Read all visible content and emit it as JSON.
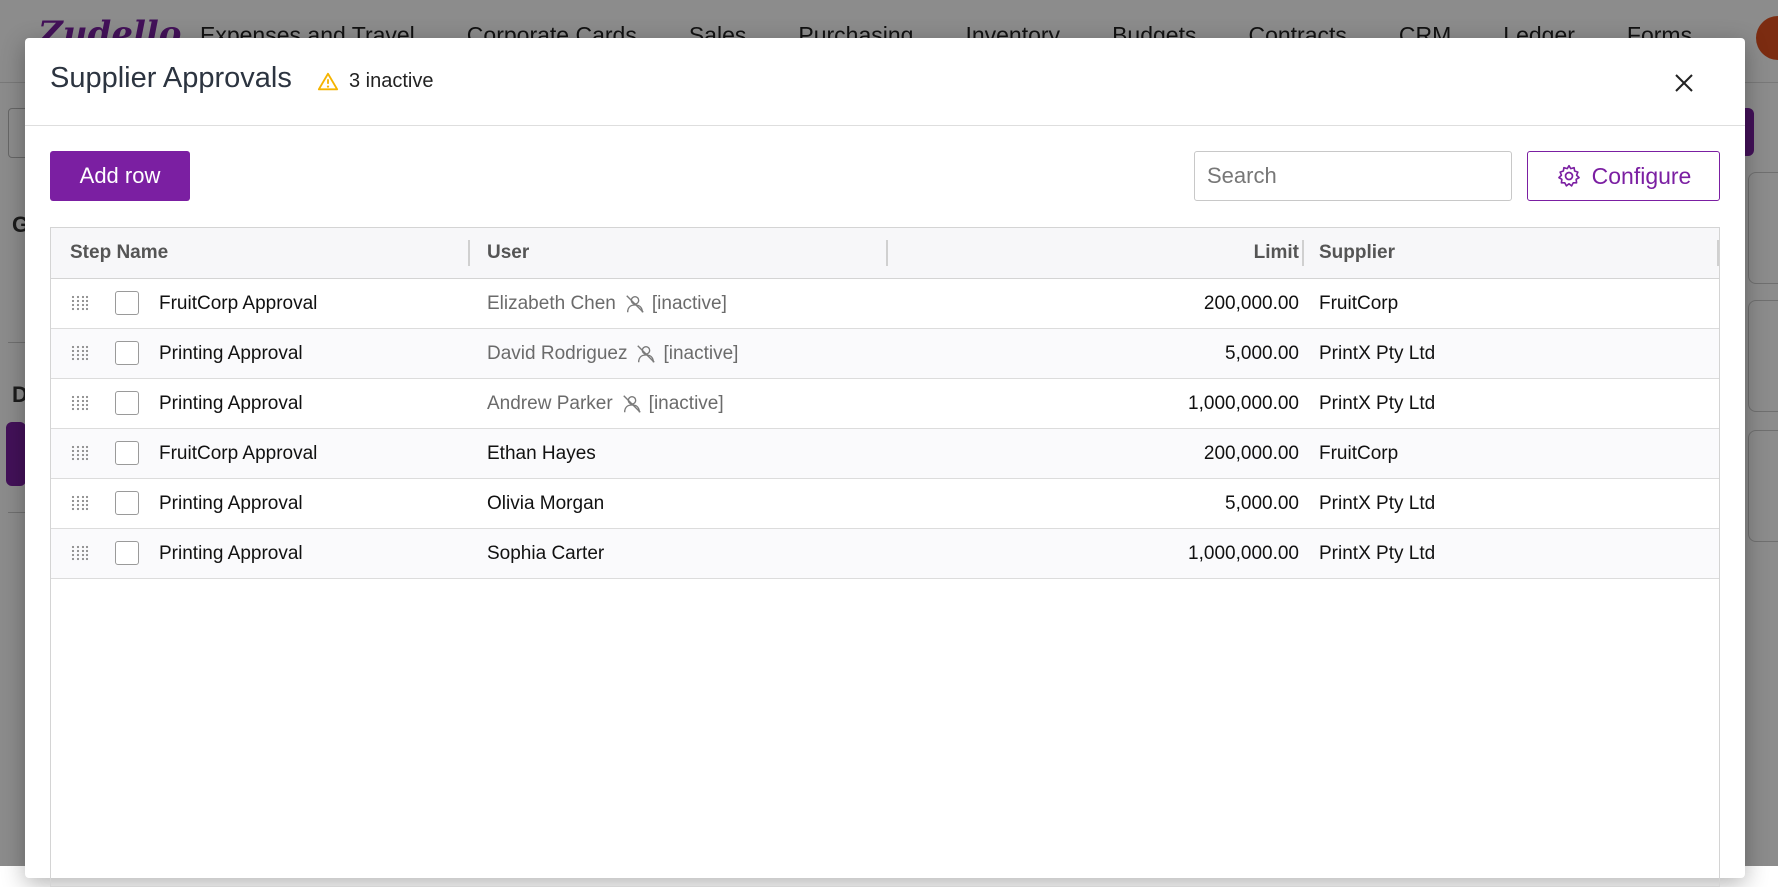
{
  "app": {
    "logo": "Zudello",
    "nav": [
      "Expenses and Travel",
      "Corporate Cards",
      "Sales",
      "Purchasing",
      "Inventory",
      "Budgets",
      "Contracts",
      "CRM",
      "Ledger",
      "Forms"
    ]
  },
  "modal": {
    "title": "Supplier Approvals",
    "warning_text": "3 inactive",
    "add_row_label": "Add row",
    "search_placeholder": "Search",
    "configure_label": "Configure"
  },
  "table": {
    "columns": [
      "Step Name",
      "User",
      "Limit",
      "Supplier"
    ],
    "rows": [
      {
        "step": "FruitCorp Approval",
        "user": "Elizabeth Chen",
        "inactive": "[inactive]",
        "limit": "200,000.00",
        "supplier": "FruitCorp"
      },
      {
        "step": "Printing Approval",
        "user": "David Rodriguez",
        "inactive": "[inactive]",
        "limit": "5,000.00",
        "supplier": "PrintX Pty Ltd"
      },
      {
        "step": "Printing Approval",
        "user": "Andrew Parker",
        "inactive": "[inactive]",
        "limit": "1,000,000.00",
        "supplier": "PrintX Pty Ltd"
      },
      {
        "step": "FruitCorp Approval",
        "user": "Ethan Hayes",
        "inactive": "",
        "limit": "200,000.00",
        "supplier": "FruitCorp"
      },
      {
        "step": "Printing Approval",
        "user": "Olivia Morgan",
        "inactive": "",
        "limit": "5,000.00",
        "supplier": "PrintX Pty Ltd"
      },
      {
        "step": "Printing Approval",
        "user": "Sophia Carter",
        "inactive": "",
        "limit": "1,000,000.00",
        "supplier": "PrintX Pty Ltd"
      }
    ]
  },
  "colors": {
    "accent": "#7b1fa2",
    "warning": "#f5b400"
  },
  "icons": [
    "warning-icon",
    "close-icon",
    "gear-icon",
    "drag-handle-icon",
    "inactive-user-icon"
  ]
}
